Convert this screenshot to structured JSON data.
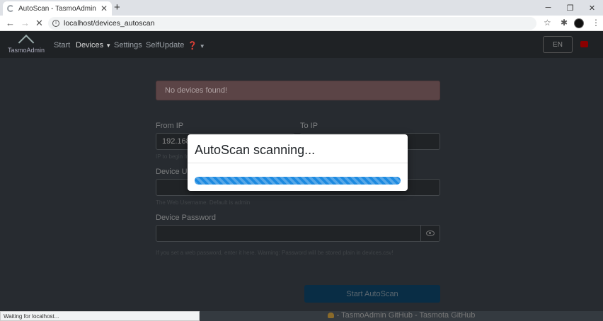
{
  "browser": {
    "tab_title": "AutoScan - TasmoAdmin",
    "url": "localhost/devices_autoscan",
    "status_text": "Waiting for localhost..."
  },
  "nav": {
    "brand": "TasmoAdmin",
    "start": "Start",
    "devices": "Devices",
    "settings": "Settings",
    "selfupdate": "SelfUpdate",
    "language": "EN"
  },
  "alert": {
    "text": "No devices found!"
  },
  "form": {
    "from_ip_label": "From IP",
    "from_ip_value": "192.168.",
    "from_ip_hint": "IP to begin fr",
    "to_ip_label": "To IP",
    "user_label": "Device Use",
    "user_hint": "The Web Username. Default is admin",
    "password_label": "Device Password",
    "password_hint": "If you set a web password, enter it here. Warning: Password will be stored plain in devices.csv!",
    "submit_label": "Start AutoScan"
  },
  "footer": {
    "links": "- TasmoAdmin GitHub - Tasmota GitHub"
  },
  "modal": {
    "title": "AutoScan scanning...",
    "progress_percent": 100
  }
}
